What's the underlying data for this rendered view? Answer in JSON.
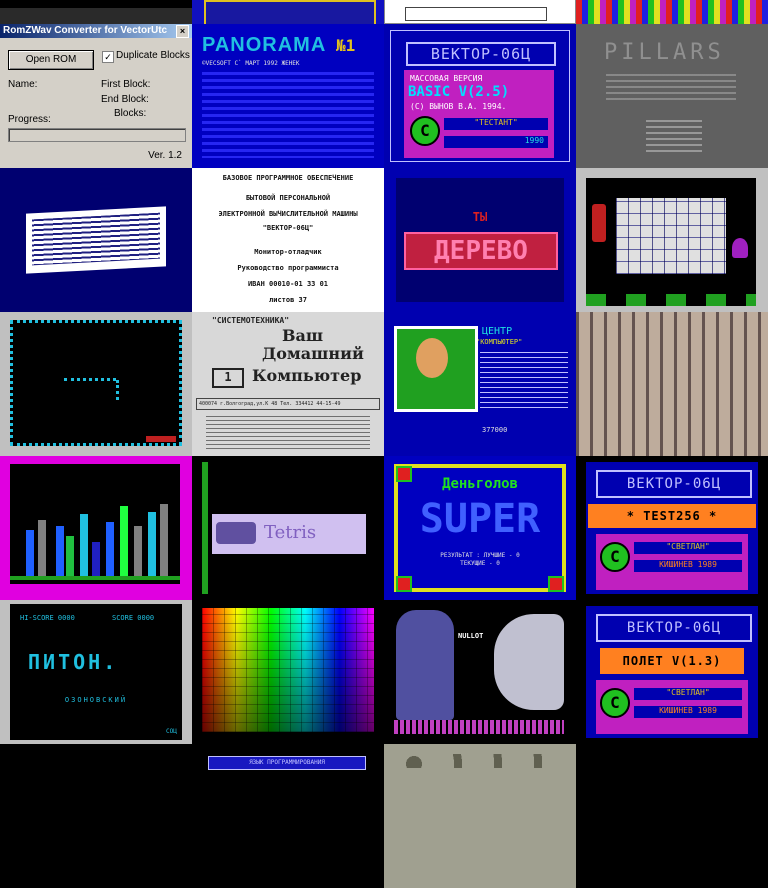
{
  "dialog": {
    "title": "RomZWav Converter for VectorUtc",
    "open_button": "Open ROM",
    "checkbox_label": "Duplicate Blocks",
    "name_label": "Name:",
    "first_block_label": "First Block:",
    "end_block_label": "End Block:",
    "blocks_label": "Blocks:",
    "progress_label": "Progress:",
    "version": "Ver. 1.2"
  },
  "tiles": {
    "panorama": {
      "brand": "PANORAMA",
      "issue": "№1",
      "sub": "©VECSOFT C` MAPT 1992 ЖЕНЕК"
    },
    "basic": {
      "title": "ВЕКТОР-06Ц",
      "lead": "МАССОВАЯ ВЕРСИЯ",
      "version": "BASIC V(2.5)",
      "author": "(С) ВЫНОВ В.А. 1994.",
      "brand": "\"ТЕСТАНТ\"",
      "year": "1990"
    },
    "pillars": {
      "title": "PILLARS"
    },
    "manual": {
      "line1": "БАЗОВОЕ ПРОГРАММНОЕ ОБЕСПЕЧЕНИЕ",
      "line2": "БЫТОВОЙ ПЕРСОНАЛЬНОЙ",
      "line3": "ЭЛЕКТРОННОЙ ВЫЧИСЛИТЕЛЬНОЙ МАШИНЫ",
      "line4": "\"ВЕКТОР-06Ц\"",
      "line5": "Монитор-отладчик",
      "line6": "Руководство программиста",
      "line7": "ИВАН 00010-01 33 01",
      "line8": "листов 37"
    },
    "derevo": {
      "small": "ТЫ",
      "big": "ДЕРЕВО"
    },
    "magazine": {
      "publisher": "\"СИСТЕМОТЕХНИКА\"",
      "line1": "Ваш",
      "line2": "Домашний",
      "line3": "Компьютер",
      "num": "1",
      "address": "400074 г.Волгоград,ул.К 48 Тел. 334412 44-15-49"
    },
    "center": {
      "title": "ЦЕНТР",
      "subtitle": "\"КОМПЬЮТЕР\"",
      "code": "377000"
    },
    "tetris": {
      "title": "Tetris"
    },
    "money": {
      "name": "Деньголов",
      "big": "SUPER",
      "result": "РЕЗУЛЬТАТ : ЛУЧШИЕ - 0",
      "now": "ТЕКУЩИЕ - 0"
    },
    "test256": {
      "title": "ВЕКТОР-06Ц",
      "label": "* TEST256 *",
      "brand": "\"СВЕТЛАН\"",
      "city": "КИШИНЕВ 1989"
    },
    "python": {
      "hiscore": "HI-SCORE 0000",
      "score": "SCORE 0000",
      "title": "ПИТОН.",
      "by": "ОЗОНОВСКИЙ",
      "corner": "СОЦ"
    },
    "polet": {
      "title": "ВЕКТОР-06Ц",
      "label": "ПОЛЕТ V(1.3)",
      "brand": "\"СВЕТЛАН\"",
      "city": "КИШИНЕВ 1989"
    },
    "portrait": {
      "word": "NULLOT"
    },
    "bottom": {
      "label": "ЯЗЫК ПРОГРАММИРОВАНИЯ"
    }
  },
  "colors": {
    "vector_blue": "#0000b0",
    "vector_orange": "#ff8020",
    "vector_green": "#20c020",
    "vector_magenta": "#c020c0"
  }
}
